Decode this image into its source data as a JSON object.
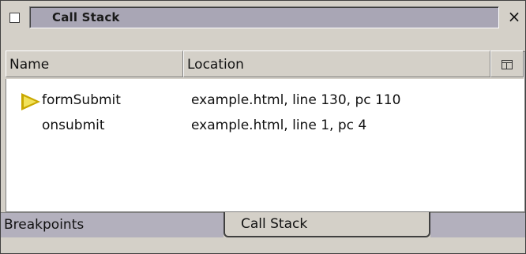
{
  "panel": {
    "title": "Call Stack",
    "close_icon": "×"
  },
  "columns": {
    "name": "Name",
    "location": "Location",
    "picker_icon": "column-picker-icon"
  },
  "frames": [
    {
      "name": "formSubmit",
      "location": "example.html, line 130, pc 110",
      "current": true
    },
    {
      "name": "onsubmit",
      "location": "example.html, line 1, pc 4",
      "current": false
    }
  ],
  "tabs": [
    {
      "label": "Breakpoints",
      "active": false
    },
    {
      "label": "Call Stack",
      "active": true
    }
  ],
  "colors": {
    "title_panel": "#a9a6b5",
    "current_frame_arrow": "#f2e25a",
    "inactive_tab": "#b3b0bd"
  }
}
